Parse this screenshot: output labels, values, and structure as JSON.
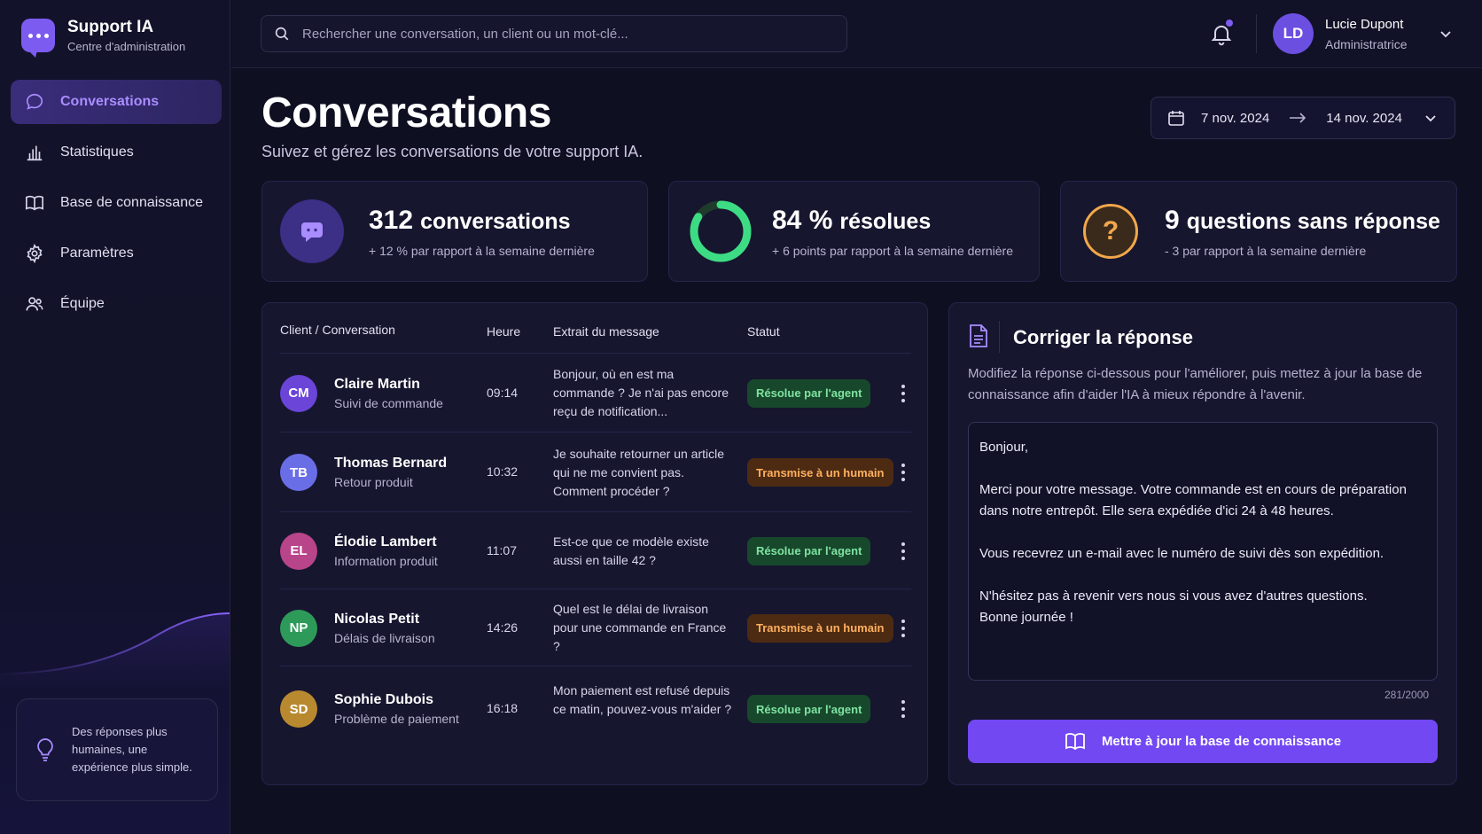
{
  "brand": {
    "title": "Support IA",
    "subtitle": "Centre d'administration"
  },
  "nav": [
    {
      "label": "Conversations",
      "icon": "chat-bubble-icon",
      "active": true
    },
    {
      "label": "Statistiques",
      "icon": "bar-chart-icon"
    },
    {
      "label": "Base de connaissance",
      "icon": "book-icon"
    },
    {
      "label": "Paramètres",
      "icon": "gear-icon"
    },
    {
      "label": "Équipe",
      "icon": "team-icon"
    }
  ],
  "promo": {
    "text": "Des réponses plus humaines, une expérience plus simple."
  },
  "search": {
    "placeholder": "Rechercher une conversation, un client ou un mot-clé..."
  },
  "user": {
    "initials": "LD",
    "name": "Lucie Dupont",
    "role": "Administratrice"
  },
  "header": {
    "title": "Conversations",
    "subtitle": "Suivez et gérez les conversations de votre support IA."
  },
  "daterange": {
    "start": "7 nov. 2024",
    "end": "14 nov. 2024"
  },
  "stats": [
    {
      "value": "312",
      "label": "conversations",
      "note": "+ 12 % par rapport à la semaine dernière"
    },
    {
      "value": "84 %",
      "label": "résolues",
      "note": "+ 6 points par rapport à la semaine dernière",
      "fraction": 0.84
    },
    {
      "value": "9",
      "label": "questions sans réponse",
      "note": "- 3 par rapport à la semaine dernière"
    }
  ],
  "table": {
    "headers": [
      "Client / Conversation",
      "Heure",
      "Extrait du message",
      "Statut"
    ],
    "rows": [
      {
        "initials": "CM",
        "name": "Claire Martin",
        "topic": "Suivi de commande",
        "time": "09:14",
        "msg": "Bonjour, où en est ma commande ? Je n'ai pas encore reçu de notification...",
        "status": "Résolue par l'agent",
        "color": "#6a45d8"
      },
      {
        "initials": "TB",
        "name": "Thomas Bernard",
        "topic": "Retour produit",
        "time": "10:32",
        "msg": "Je souhaite retourner un article qui ne me convient pas. Comment procéder ?",
        "status": "Transmise à un humain",
        "color": "#6a6ee6"
      },
      {
        "initials": "EL",
        "name": "Élodie Lambert",
        "topic": "Information produit",
        "time": "11:07",
        "msg": "Est-ce que ce modèle existe aussi en taille 42 ?",
        "status": "Résolue par l'agent",
        "color": "#b8448a"
      },
      {
        "initials": "NP",
        "name": "Nicolas Petit",
        "topic": "Délais de livraison",
        "time": "14:26",
        "msg": "Quel est le délai de livraison pour une commande en France ?",
        "status": "Transmise à un humain",
        "color": "#2e9a5a"
      },
      {
        "initials": "SD",
        "name": "Sophie Dubois",
        "topic": "Problème de paiement",
        "time": "16:18",
        "msg": "Mon paiement est refusé depuis ce matin, pouvez-vous m'aider ?",
        "status": "Résolue par l'agent",
        "color": "#b8892f"
      }
    ]
  },
  "editor": {
    "title": "Corriger la réponse",
    "description": "Modifiez la réponse ci-dessous pour l'améliorer, puis mettez à jour la base de connaissance afin d'aider l'IA à mieux répondre à l'avenir.",
    "lines": [
      "Bonjour,",
      "",
      "Merci pour votre message. Votre commande est en cours de préparation dans notre entrepôt. Elle sera expédiée d'ici 24 à 48 heures.",
      "",
      "Vous recevrez un e-mail avec le numéro de suivi dès son expédition.",
      "",
      "N'hésitez pas à revenir vers nous si vous avez d'autres questions.",
      "Bonne journée !"
    ],
    "count": "281/2000",
    "button": "Mettre à jour la base de connaissance"
  },
  "colors": {
    "accent": "#7c5cf0",
    "success": "#7fe3a0",
    "warning": "#ffb05e",
    "ring": "#3ddc84",
    "question": "#f2a74a"
  }
}
